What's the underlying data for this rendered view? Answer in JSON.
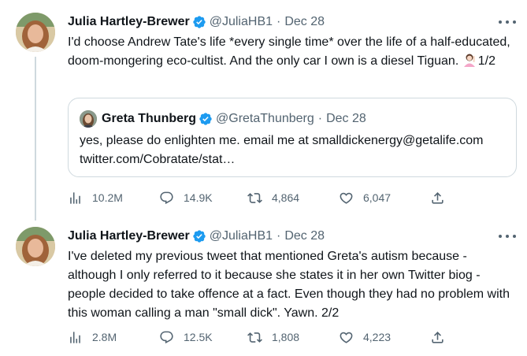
{
  "tweets": [
    {
      "author_name": "Julia Hartley-Brewer",
      "handle": "@JuliaHB1",
      "separator": "·",
      "date": "Dec 28",
      "text_main": "I'd choose Andrew Tate's life *every single time* over the life of a half-educated, doom-mongering eco-cultist. And the only car I own is a diesel Tiguan. ",
      "text_suffix": "1/2",
      "emoji": "woman-raising-hand-emoji",
      "quote": {
        "author_name": "Greta Thunberg",
        "handle": "@GretaThunberg",
        "separator": "·",
        "date": "Dec 28",
        "text_line1": "yes, please do enlighten me. email me at smalldickenergy@getalife.com",
        "text_line2": "twitter.com/Cobratate/stat…"
      },
      "stats": {
        "views": "10.2M",
        "replies": "14.9K",
        "retweets": "4,864",
        "likes": "6,047"
      }
    },
    {
      "author_name": "Julia Hartley-Brewer",
      "handle": "@JuliaHB1",
      "separator": "·",
      "date": "Dec 28",
      "text": "I've deleted my previous tweet that mentioned Greta's autism because - although I only referred to it because she states it in her own Twitter biog - people decided to take offence at a fact. Even though they had no problem with this woman calling a man \"small dick\". Yawn. 2/2",
      "stats": {
        "views": "2.8M",
        "replies": "12.5K",
        "retweets": "1,808",
        "likes": "4,223"
      }
    }
  ],
  "colors": {
    "text": "#0f1419",
    "secondary": "#536471",
    "verified": "#1d9bf0",
    "border": "#cfd9de"
  },
  "icons": [
    "verified-badge-icon",
    "more-icon",
    "views-icon",
    "reply-icon",
    "retweet-icon",
    "like-icon",
    "share-icon"
  ]
}
